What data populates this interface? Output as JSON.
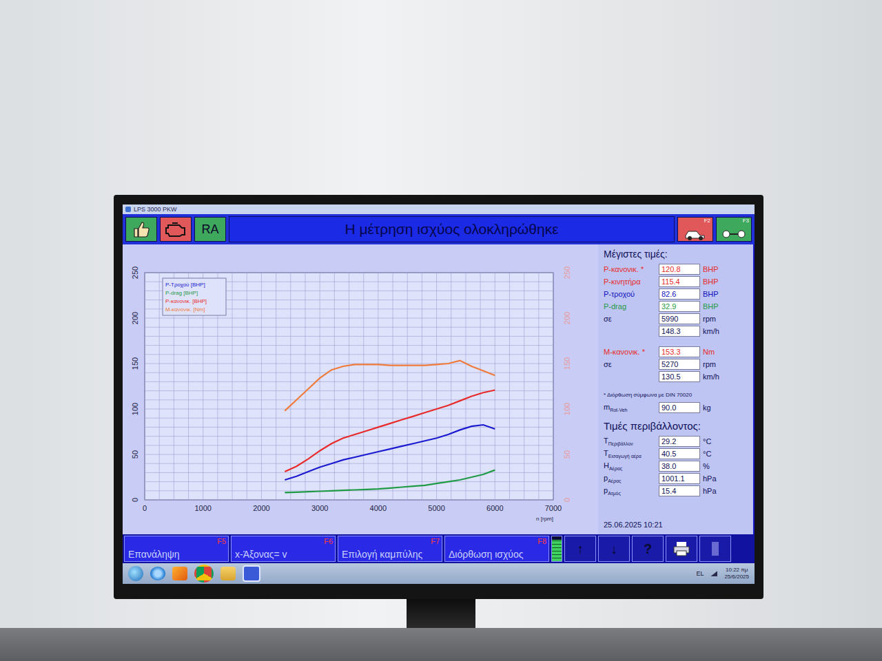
{
  "window": {
    "title": "LPS 3000 PKW"
  },
  "toolbar": {
    "ra_label": "RA",
    "banner": "Η μέτρηση ισχύος ολοκληρώθηκε",
    "right_keys": [
      "F2",
      "F3"
    ]
  },
  "chart": {
    "y_ticks": [
      "0",
      "50",
      "100",
      "150",
      "200",
      "250"
    ],
    "y_right_ticks": [
      "0",
      "50",
      "100",
      "150",
      "200",
      "250"
    ],
    "x_ticks": [
      "0",
      "1000",
      "2000",
      "3000",
      "4000",
      "5000",
      "6000",
      "7000"
    ],
    "x_label": "n [rpm]",
    "rpm": [
      2400,
      2600,
      2800,
      3000,
      3200,
      3400,
      3600,
      3800,
      4000,
      4200,
      4400,
      4600,
      4800,
      5000,
      5200,
      5400,
      5600,
      5800,
      6000
    ],
    "series": [
      {
        "name": "P-Τροχού [BHP]",
        "color": "#1a1ad0",
        "values": [
          22,
          26,
          31,
          36,
          40,
          44,
          47,
          50,
          53,
          56,
          59,
          62,
          65,
          68,
          72,
          77,
          81,
          82.6,
          78
        ]
      },
      {
        "name": "P-drag [BHP]",
        "color": "#1f9a45",
        "values": [
          8,
          8.5,
          9,
          9.5,
          10,
          10.5,
          11,
          11.5,
          12,
          13,
          14,
          15,
          16,
          18,
          20,
          22,
          25,
          28,
          32.9
        ]
      },
      {
        "name": "P-κανονικ. [BHP]",
        "color": "#e82a2a",
        "values": [
          31,
          37,
          45,
          54,
          62,
          68,
          72,
          76,
          80,
          84,
          88,
          92,
          96,
          100,
          104,
          109,
          114,
          118,
          120.8
        ]
      },
      {
        "name": "M-κανονικ. [Nm]",
        "color": "#f07a3a",
        "values": [
          98,
          110,
          122,
          134,
          143,
          147,
          149,
          149,
          149,
          148,
          148,
          148,
          148,
          149,
          150,
          153.3,
          147,
          142,
          137
        ]
      }
    ]
  },
  "max_values": {
    "title": "Μέγιστες τιμές:",
    "groups": [
      [
        {
          "label": "P-κανονικ. *",
          "value": "120.8",
          "unit": "BHP",
          "color": "#e82a2a"
        },
        {
          "label": "P-κινητήρα",
          "value": "115.4",
          "unit": "BHP",
          "color": "#e82a2a"
        },
        {
          "label": "P-τροχού",
          "value": "82.6",
          "unit": "BHP",
          "color": "#1010c0"
        },
        {
          "label": "P-drag",
          "value": "32.9",
          "unit": "BHP",
          "color": "#1f9a45"
        },
        {
          "label": "σε",
          "value": "5990",
          "unit": "rpm",
          "color": "#10105a"
        },
        {
          "label": "",
          "value": "148.3",
          "unit": "km/h",
          "color": "#10105a"
        }
      ],
      [
        {
          "label": "M-κανονικ. *",
          "value": "153.3",
          "unit": "Nm",
          "color": "#e82a2a"
        },
        {
          "label": "σε",
          "value": "5270",
          "unit": "rpm",
          "color": "#10105a"
        },
        {
          "label": "",
          "value": "130.5",
          "unit": "km/h",
          "color": "#10105a"
        }
      ]
    ],
    "note": "* Διόρθωση σύμφωνα με DIN 70020",
    "mass": {
      "label": "m",
      "sub": "Rot-Veh",
      "value": "90.0",
      "unit": "kg"
    }
  },
  "environment": {
    "title": "Τιμές περιβάλλοντος:",
    "rows": [
      {
        "label": "T",
        "sub": "Περιβάλλον",
        "value": "29.2",
        "unit": "°C"
      },
      {
        "label": "T",
        "sub": "Εισαγωγή αέρα",
        "value": "40.5",
        "unit": "°C"
      },
      {
        "label": "H",
        "sub": "Αέρας",
        "value": "38.0",
        "unit": "%"
      },
      {
        "label": "p",
        "sub": "Αέρας",
        "value": "1001.1",
        "unit": "hPa"
      },
      {
        "label": "p",
        "sub": "Ατμός",
        "value": "15.4",
        "unit": "hPa"
      }
    ]
  },
  "timestamp": "25.06.2025  10:21",
  "function_keys": [
    {
      "label": "Επανάληψη",
      "key": "F5"
    },
    {
      "label": "x-Άξονας= v",
      "key": "F6"
    },
    {
      "label": "Επιλογή καμπύλης",
      "key": "F7"
    },
    {
      "label": "Διόρθωση ισχύος",
      "key": "F8"
    }
  ],
  "indicator": {
    "level": 0.85
  },
  "tools": [
    {
      "kind": "text",
      "label": "↑"
    },
    {
      "kind": "text",
      "label": "↓"
    },
    {
      "kind": "text",
      "label": "?"
    },
    {
      "kind": "print",
      "label": ""
    },
    {
      "kind": "blank",
      "label": ""
    }
  ],
  "taskbar": {
    "lang": "EL",
    "time": "10:22 πμ",
    "date": "25/6/2025"
  }
}
